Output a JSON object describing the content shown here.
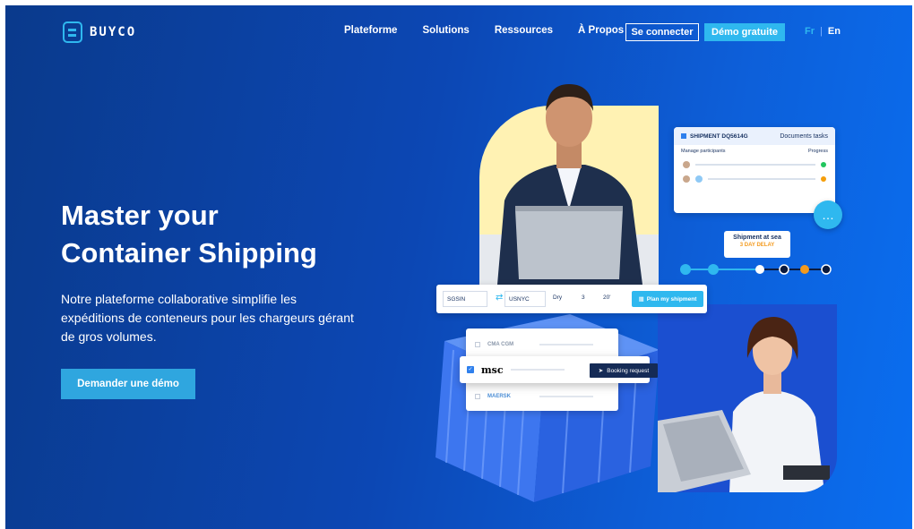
{
  "brand": {
    "name": "BUYCO",
    "accent": "#2fb8ef",
    "bg": "#0c47b4"
  },
  "nav": {
    "items": [
      "Plateforme",
      "Solutions",
      "Ressources",
      "À Propos"
    ],
    "login": "Se connecter",
    "demo": "Démo gratuite",
    "lang_fr": "Fr",
    "lang_sep": "|",
    "lang_en": "En"
  },
  "hero": {
    "title_line1": "Master your",
    "title_line2": "Container Shipping",
    "subtitle": "Notre plateforme collaborative simplifie les expéditions de conteneurs pour les chargeurs gérant de gros volumes.",
    "cta": "Demander une démo"
  },
  "widgets": {
    "shipment_title": "SHIPMENT DQ5614G",
    "documents_tab": "Documents tasks",
    "manage_participants": "Manage participants",
    "progress": "Progress",
    "sea_status": "Shipment at sea",
    "sea_delay": "3 DAY DELAY",
    "from_port": "SGSIN",
    "to_port": "USNYC",
    "container_type": "Dry",
    "quantity": "3",
    "container_size": "20'",
    "plan_button": "Plan my shipment",
    "carriers": [
      "CMA CGM",
      "msc",
      "MAERSK"
    ],
    "booking_button": "Booking request"
  }
}
